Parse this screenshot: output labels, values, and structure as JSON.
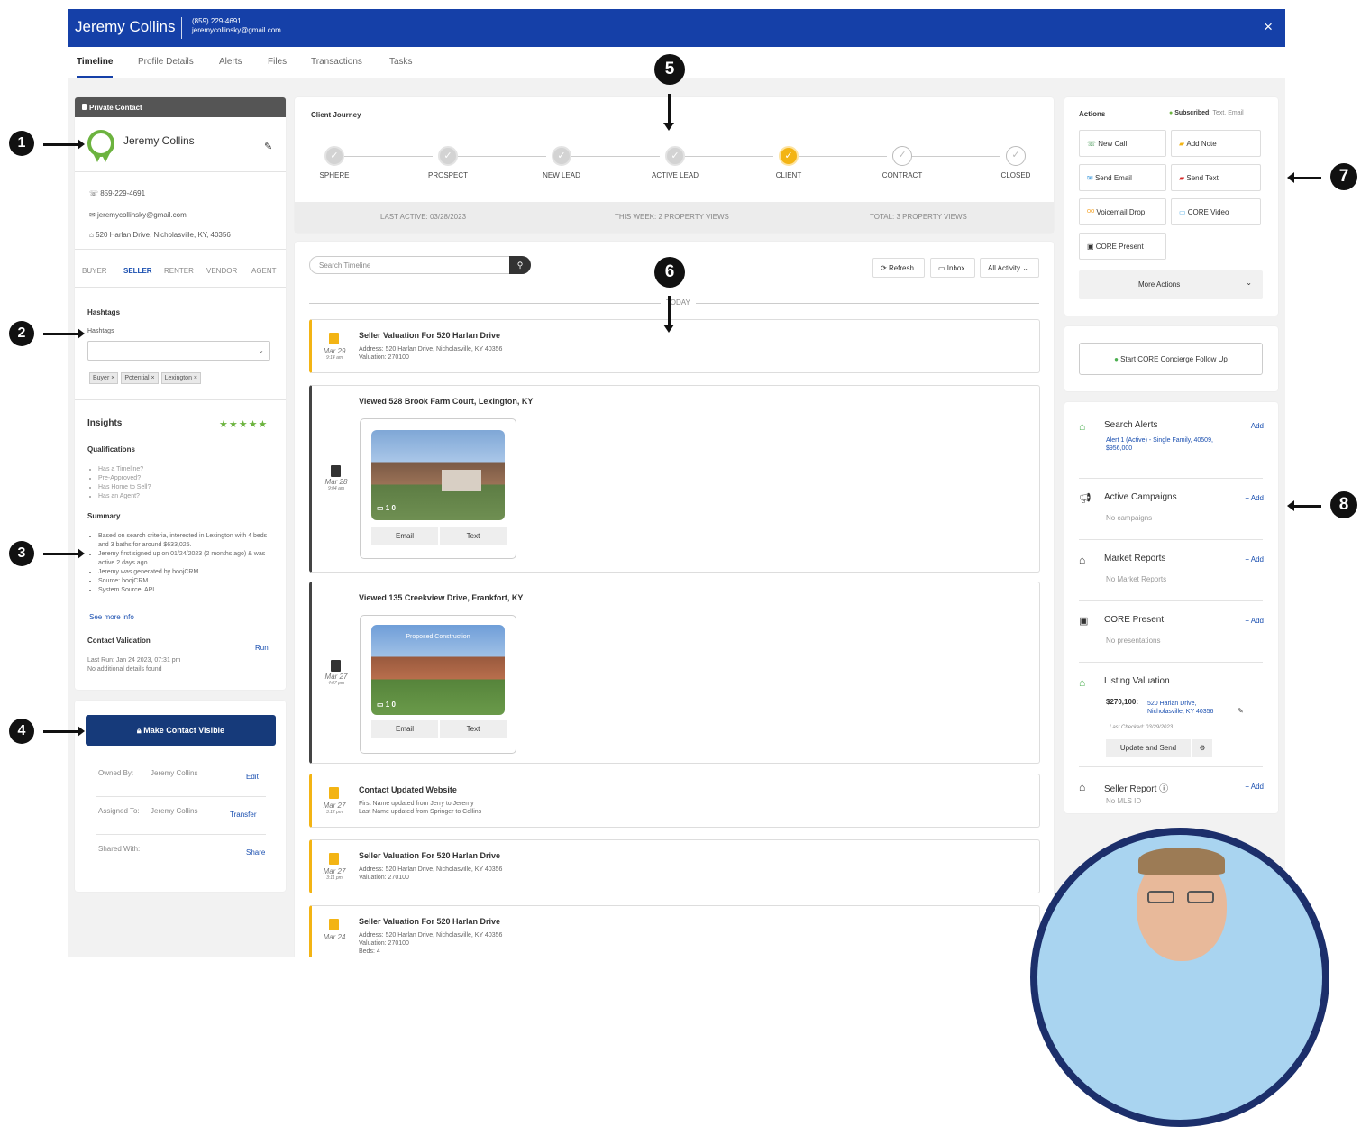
{
  "header": {
    "name": "Jeremy Collins",
    "phone": "(859) 229-4691",
    "email": "jeremycollinsky@gmail.com",
    "close": "×"
  },
  "tabs": [
    "Timeline",
    "Profile Details",
    "Alerts",
    "Files",
    "Transactions",
    "Tasks"
  ],
  "contact": {
    "private_label": "Private Contact",
    "name": "Jeremy Collins",
    "phone": "859-229-4691",
    "email": "jeremycollinsky@gmail.com",
    "address": "520 Harlan Drive, Nicholasville, KY, 40356",
    "roles": [
      "BUYER",
      "SELLER",
      "RENTER",
      "VENDOR",
      "AGENT"
    ],
    "active_role": "SELLER",
    "hashtags_heading": "Hashtags",
    "hashtags_label": "Hashtags",
    "hashtags": [
      "Buyer ×",
      "Potential ×",
      "Lexington ×"
    ]
  },
  "insights": {
    "title": "Insights",
    "stars": "★★★★★",
    "qual_title": "Qualifications",
    "qualifications": [
      "Has a Timeline?",
      "Pre-Approved?",
      "Has Home to Sell?",
      "Has an Agent?"
    ],
    "summary_title": "Summary",
    "summary": [
      "Based on search criteria, interested in Lexington",
      "with 4 beds and 3 baths for around $633,025.",
      "Jeremy first signed up on 01/24/2023 (2",
      "months ago) & was active 2 days ago.",
      "Jeremy was generated by boojCRM.",
      "Source: boojCRM",
      "System Source: API"
    ],
    "see_more": "See more info",
    "validation_title": "Contact Validation",
    "run": "Run",
    "last_run": "Last Run: Jan 24 2023, 07:31 pm",
    "no_details": "No additional details found"
  },
  "visibility": {
    "button": "Make Contact Visible",
    "owned_label": "Owned By:",
    "owned_value": "Jeremy Collins",
    "edit": "Edit",
    "assigned_label": "Assigned To:",
    "assigned_value": "Jeremy Collins",
    "transfer": "Transfer",
    "shared_label": "Shared With:",
    "share": "Share"
  },
  "journey": {
    "title": "Client Journey",
    "steps": [
      "SPHERE",
      "PROSPECT",
      "NEW LEAD",
      "ACTIVE LEAD",
      "CLIENT",
      "CONTRACT",
      "CLOSED"
    ],
    "current_step": "CLIENT",
    "last_active": "LAST ACTIVE: 03/28/2023",
    "this_week": "THIS WEEK: 2 PROPERTY VIEWS",
    "total": "TOTAL: 3 PROPERTY VIEWS"
  },
  "timeline": {
    "search_placeholder": "Search Timeline",
    "refresh": "Refresh",
    "inbox": "Inbox",
    "all_activity": "All Activity",
    "today": "TODAY",
    "events": [
      {
        "title": "Seller Valuation For 520 Harlan Drive",
        "date": "Mar 29",
        "time": "9:14 am",
        "lines": [
          "Address: 520 Harlan Drive, Nicholasville, KY 40356",
          "Valuation: 270100"
        ]
      },
      {
        "title": "Viewed 528 Brook Farm Court, Lexington, KY",
        "date": "Mar 28",
        "time": "9:04 am",
        "counts": "1   0",
        "email": "Email",
        "text": "Text"
      },
      {
        "title": "Viewed 135 Creekview Drive, Frankfort, KY",
        "date": "Mar 27",
        "time": "4:07 pm",
        "banner": "Proposed Construction",
        "counts": "1   0",
        "email": "Email",
        "text": "Text"
      },
      {
        "title": "Contact Updated Website",
        "date": "Mar 27",
        "time": "3:12 pm",
        "lines": [
          "First Name updated from Jerry to Jeremy",
          "Last Name updated from Springer to Collins"
        ]
      },
      {
        "title": "Seller Valuation For 520 Harlan Drive",
        "date": "Mar 27",
        "time": "3:11 pm",
        "lines": [
          "Address: 520 Harlan Drive, Nicholasville, KY 40356",
          "Valuation: 270100"
        ]
      },
      {
        "title": "Seller Valuation For 520 Harlan Drive",
        "date": "Mar 24",
        "time": "",
        "lines": [
          "Address: 520 Harlan Drive, Nicholasville, KY 40356",
          "Valuation: 270100",
          "Beds: 4"
        ]
      }
    ]
  },
  "actions": {
    "title": "Actions",
    "subscribed_label": "Subscribed:",
    "subscribed_value": "Text, Email",
    "buttons": [
      "New Call",
      "Add Note",
      "Send Email",
      "Send Text",
      "Voicemail Drop",
      "CORE Video",
      "CORE Present"
    ],
    "more": "More Actions",
    "concierge": "Start CORE Concierge Follow Up"
  },
  "right_sections": {
    "add": "+ Add",
    "search_alerts": "Search Alerts",
    "alert_line1": "Alert 1 (Active) - Single Family, 40509,",
    "alert_line2": "$956,000",
    "campaigns": "Active Campaigns",
    "no_campaigns": "No campaigns",
    "market": "Market Reports",
    "no_market": "No Market Reports",
    "core_present": "CORE Present",
    "no_presentations": "No presentations",
    "listing": "Listing Valuation",
    "listing_value": "$270,100:",
    "listing_addr1": "520 Harlan Drive,",
    "listing_addr2": "Nicholasville, KY 40356",
    "last_checked": "Last Checked: 03/29/2023",
    "update_send": "Update and Send",
    "seller_report": "Seller Report",
    "no_mls": "No MLS ID"
  },
  "annotations": [
    "1",
    "2",
    "3",
    "4",
    "5",
    "6",
    "7",
    "8"
  ],
  "colors": {
    "brand": "#1540a8",
    "accent": "#f3b414",
    "navy_button": "#163a7a",
    "avatar_bg": "#a9d4f0"
  }
}
